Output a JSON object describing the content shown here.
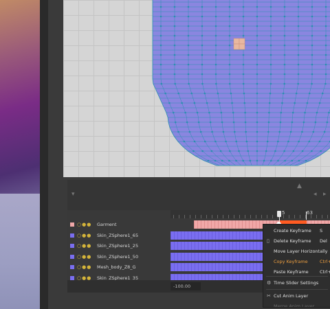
{
  "timeline": {
    "frame_labels": [
      "5",
      "63"
    ],
    "tracks": [
      {
        "name": "Garment",
        "swatch": "#f0a8a8",
        "kind": "garment"
      },
      {
        "name": "Skin_ZSphere1_65",
        "swatch": "#7a6ef0",
        "kind": "layer"
      },
      {
        "name": "Skin_ZSphere1_25",
        "swatch": "#7a6ef0",
        "kind": "layer"
      },
      {
        "name": "Skin_ZSphere1_50",
        "swatch": "#7a6ef0",
        "kind": "layer"
      },
      {
        "name": "Mesh_body_Z8_G",
        "swatch": "#7a6ef0",
        "kind": "layer"
      },
      {
        "name": "Skin_ZSphere1_35",
        "swatch": "#7a6ef0",
        "kind": "layer"
      }
    ],
    "start_value": "-100.00",
    "current_frame": "43"
  },
  "context_menu": {
    "items": [
      {
        "label": "Create Keyframe",
        "shortcut": "S"
      },
      {
        "label": "Delete Keyframe",
        "shortcut": "Del"
      },
      {
        "label": "Move Layer Horizontally",
        "shortcut": ""
      },
      {
        "label": "Copy Keyframe",
        "shortcut": "Ctrl+",
        "active": true
      },
      {
        "label": "Paste Keyframe",
        "shortcut": "Ctrl+"
      },
      {
        "label": "Time Slider Settings",
        "shortcut": ""
      },
      {
        "label": "Cut Anim Layer",
        "shortcut": ""
      },
      {
        "label": "Merge Anim Layer",
        "shortcut": "",
        "disabled": true
      }
    ]
  },
  "colors": {
    "mesh_fill": "#8a86e0",
    "mesh_wire": "#2a8fb0",
    "playhead_region": "#ff5b22",
    "menu_highlight": "#f0a040"
  }
}
